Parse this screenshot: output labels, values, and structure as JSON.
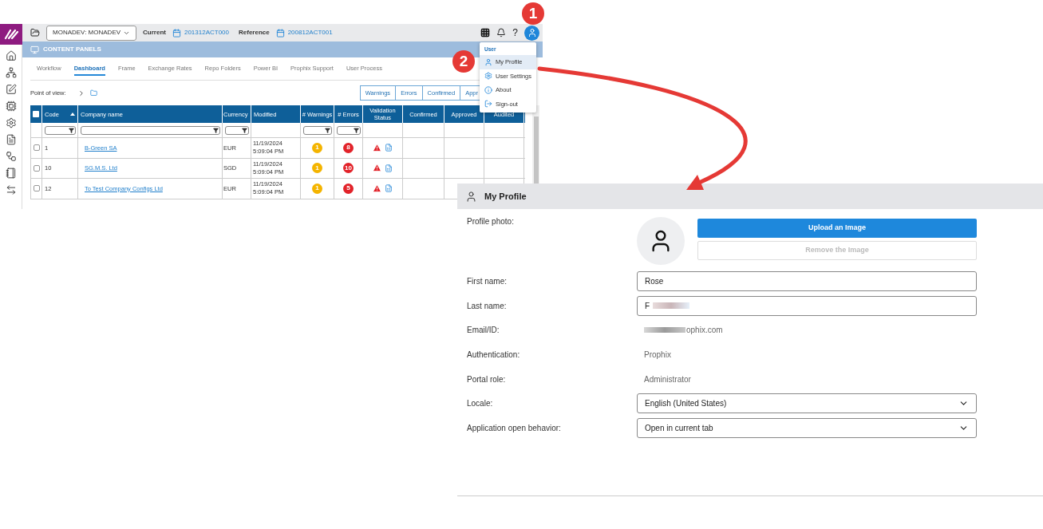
{
  "app": {
    "sidebar": {
      "items": [
        {
          "kind": "home"
        },
        {
          "kind": "sitemap"
        },
        {
          "kind": "edit"
        },
        {
          "kind": "chip"
        },
        {
          "kind": "gear"
        },
        {
          "kind": "document"
        },
        {
          "kind": "hierarchy"
        },
        {
          "kind": "notebook"
        },
        {
          "kind": "swap"
        }
      ]
    },
    "top_bar": {
      "environment": "MONADEV: MONADEV",
      "current_label": "Current",
      "current_value": "201312ACT000",
      "reference_label": "Reference",
      "reference_value": "200812ACT001",
      "help": "?"
    },
    "panel_title": "CONTENT PANELS",
    "tabs": [
      {
        "label": "Workflow",
        "selected": false
      },
      {
        "label": "Dashboard",
        "selected": true
      },
      {
        "label": "Frame",
        "selected": false
      },
      {
        "label": "Exchange Rates",
        "selected": false
      },
      {
        "label": "Repo Folders",
        "selected": false
      },
      {
        "label": "Power BI",
        "selected": false
      },
      {
        "label": "Prophix Support",
        "selected": false
      },
      {
        "label": "User Process",
        "selected": false
      }
    ],
    "point_of_view": "Point of view:",
    "filter_buttons": [
      "Warnings",
      "Errors",
      "Confirmed",
      "Appr"
    ],
    "table": {
      "all_checked": false,
      "columns": [
        {
          "label": "Code",
          "sorted": true,
          "filter": true
        },
        {
          "label": "Company name",
          "sorted": false,
          "filter": true
        },
        {
          "label": "Currency",
          "sorted": false,
          "filter": true
        },
        {
          "label": "Modified",
          "sorted": false,
          "filter": false
        },
        {
          "label": "# Warnings",
          "sorted": false,
          "filter": true
        },
        {
          "label": "# Errors",
          "sorted": false,
          "filter": true
        },
        {
          "label": "Validation Status",
          "sorted": false,
          "filter": false
        },
        {
          "label": "Confirmed",
          "sorted": false,
          "filter": false
        },
        {
          "label": "Approved",
          "sorted": false,
          "filter": false
        },
        {
          "label": "Audited",
          "sorted": false,
          "filter": false
        }
      ],
      "rows": [
        {
          "checked": false,
          "code": "1",
          "company": "B-Green SA",
          "currency": "EUR",
          "modified_date": "11/19/2024",
          "modified_time": "5:09:04 PM",
          "warnings": "1",
          "errors": "8"
        },
        {
          "checked": false,
          "code": "10",
          "company": "SG.M.S. Ltd",
          "currency": "SGD",
          "modified_date": "11/19/2024",
          "modified_time": "5:09:04 PM",
          "warnings": "1",
          "errors": "10"
        },
        {
          "checked": false,
          "code": "12",
          "company": "To Test Company Configs Ltd",
          "currency": "EUR",
          "modified_date": "11/19/2024",
          "modified_time": "5:09:04 PM",
          "warnings": "1",
          "errors": "5"
        }
      ]
    },
    "user_menu": {
      "header": "User",
      "items": [
        {
          "kind": "profile",
          "label": "My Profile",
          "selected": true
        },
        {
          "kind": "settings",
          "label": "User Settings",
          "selected": false
        },
        {
          "kind": "about",
          "label": "About",
          "selected": false
        },
        {
          "kind": "signout",
          "label": "Sign-out",
          "selected": false
        }
      ]
    }
  },
  "callouts": [
    "1",
    "2"
  ],
  "profile": {
    "title": "My Profile",
    "photo_label": "Profile photo:",
    "upload_button": "Upload an Image",
    "remove_button": {
      "label": "Remove the Image",
      "disabled": true
    },
    "fields": [
      {
        "kind": "input",
        "label": "First name:",
        "value": "Rose"
      },
      {
        "kind": "input",
        "label": "Last name:",
        "value": "F",
        "blurred": true
      },
      {
        "kind": "text",
        "label": "Email/ID:",
        "value": "ophix.com",
        "blurred": true
      },
      {
        "kind": "text",
        "label": "Authentication:",
        "value": "Prophix"
      },
      {
        "kind": "text",
        "label": "Portal role:",
        "value": "Administrator"
      },
      {
        "kind": "select",
        "label": "Locale:",
        "value": "English (United States)"
      },
      {
        "kind": "select",
        "label": "Application open behavior:",
        "value": "Open in current tab"
      }
    ]
  }
}
